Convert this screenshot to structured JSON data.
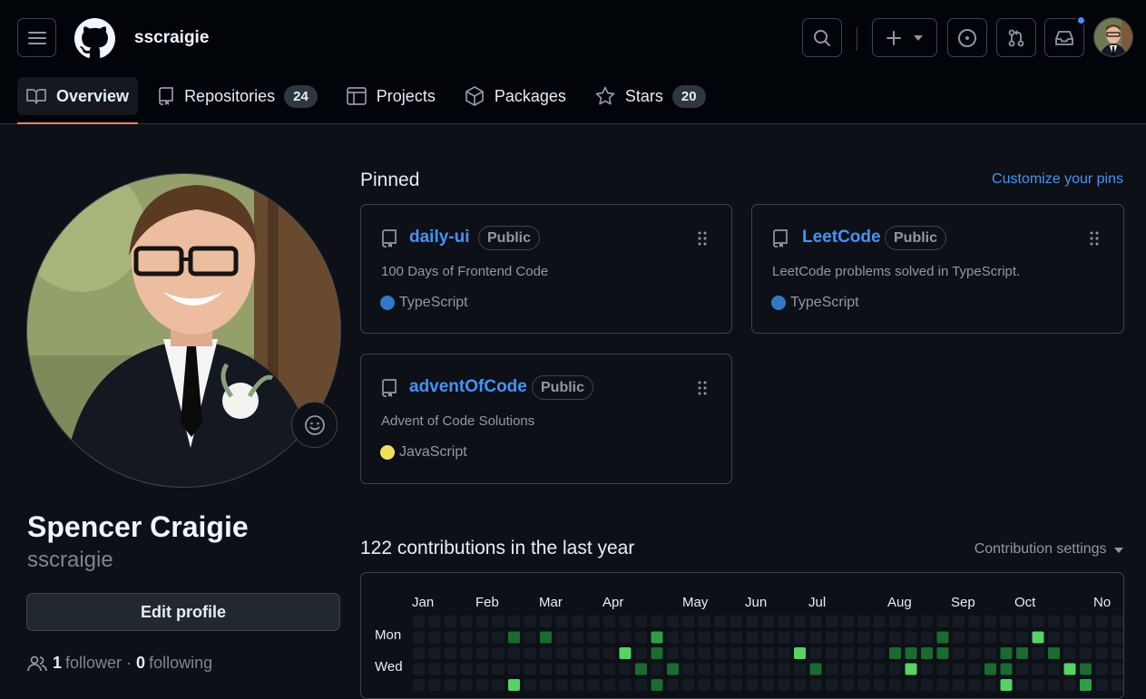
{
  "header": {
    "username": "sscraigie",
    "icons": [
      "hamburger-icon",
      "github-logo",
      "search-icon",
      "plus-icon",
      "chevron-down-icon",
      "issues-icon",
      "pull-requests-icon",
      "inbox-icon"
    ],
    "notification_color": "#4493f8"
  },
  "tabs": [
    {
      "label": "Overview",
      "icon": "book-icon",
      "active": true
    },
    {
      "label": "Repositories",
      "icon": "repo-icon",
      "count": "24"
    },
    {
      "label": "Projects",
      "icon": "table-icon"
    },
    {
      "label": "Packages",
      "icon": "package-icon"
    },
    {
      "label": "Stars",
      "icon": "star-icon",
      "count": "20"
    }
  ],
  "profile": {
    "full_name": "Spencer Craigie",
    "login": "sscraigie",
    "edit_label": "Edit profile",
    "followers": "1",
    "followers_label": "follower",
    "sep": "·",
    "following": "0",
    "following_label": "following"
  },
  "pinned": {
    "title": "Pinned",
    "customize": "Customize your pins",
    "repos": [
      {
        "name": "daily-ui",
        "visibility": "Public",
        "description": "100 Days of Frontend Code",
        "language": "TypeScript",
        "lang_color": "#3178c6"
      },
      {
        "name": "LeetCode",
        "visibility": "Public",
        "description": "LeetCode problems solved in TypeScript.",
        "language": "TypeScript",
        "lang_color": "#3178c6"
      },
      {
        "name": "adventOfCode",
        "visibility": "Public",
        "description": "Advent of Code Solutions",
        "language": "JavaScript",
        "lang_color": "#f1e05a"
      }
    ]
  },
  "contributions": {
    "title": "122 contributions in the last year",
    "settings": "Contribution settings",
    "months": [
      "Jan",
      "Feb",
      "Mar",
      "Apr",
      "May",
      "Jun",
      "Jul",
      "Aug",
      "Sep",
      "Oct",
      "No"
    ],
    "weekdays": [
      "Mon",
      "Wed"
    ],
    "colors": [
      "#151b23",
      "#033a16",
      "#196c2e",
      "#2ea043",
      "#56d364"
    ]
  }
}
